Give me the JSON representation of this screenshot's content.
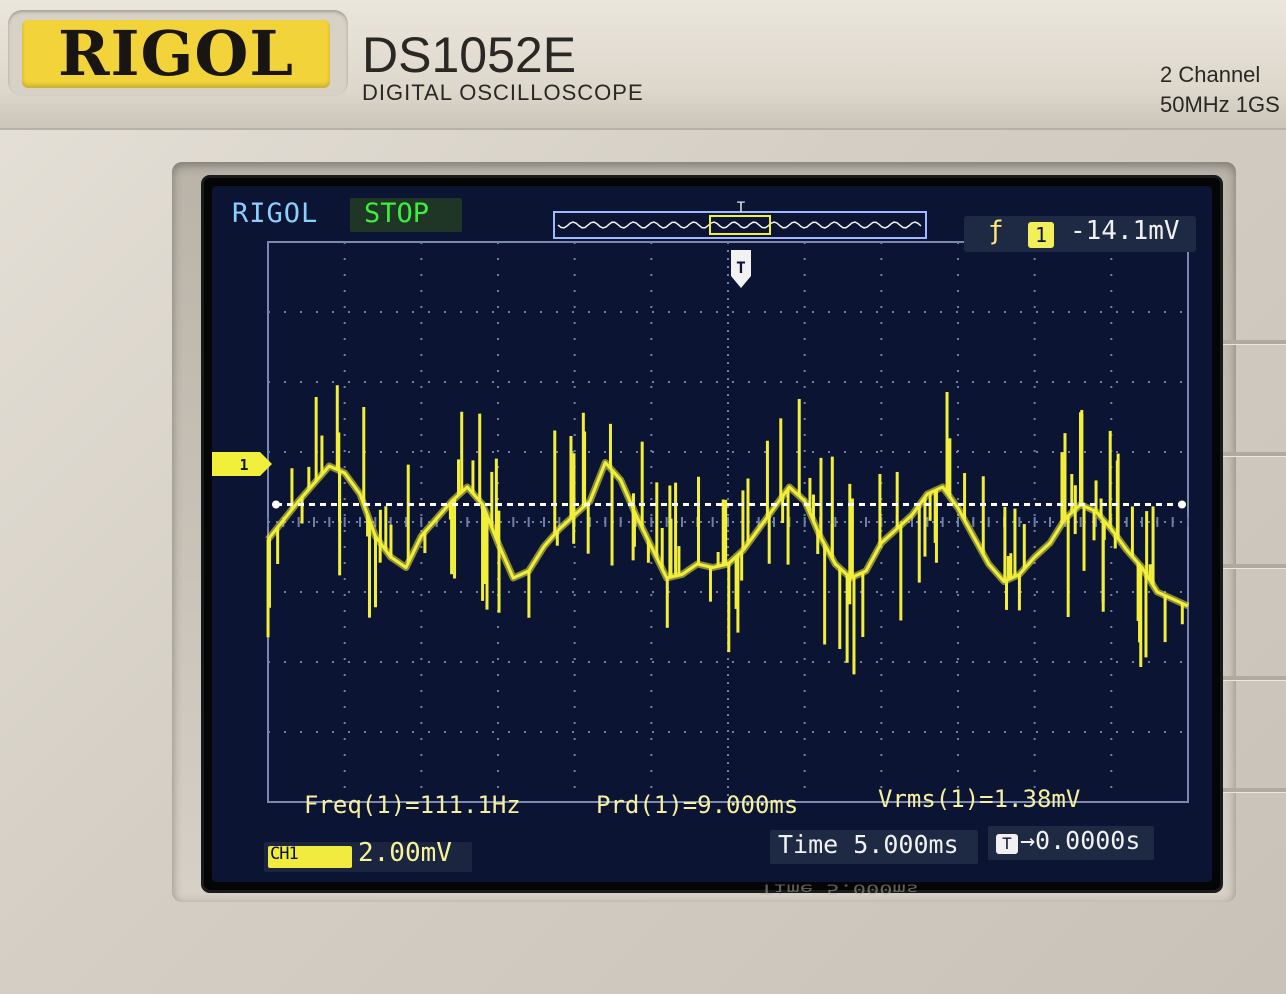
{
  "device": {
    "brand": "RIGOL",
    "model": "DS1052E",
    "subtitle": "DIGITAL OSCILLOSCOPE",
    "spec_channels": "2 Channel",
    "spec_bandwidth": "50MHz 1GS"
  },
  "screen": {
    "brand": "RIGOL",
    "run_status": "STOP",
    "trigger_edge_glyph": "ƒ",
    "trigger_channel": "1",
    "trigger_level": "-14.1mV",
    "trigger_marker": "T",
    "channel_marker": "1",
    "channel_scale_icon": "CH1",
    "channel_scale": "2.00mV",
    "timebase_label": "Time 5.000ms",
    "trigger_offset_icon": "T",
    "trigger_offset": "→0.0000s"
  },
  "measurements": {
    "frequency": "Freq(1)=111.1Hz",
    "period": "Prd(1)=9.000ms",
    "vrms": "Vrms(1)=1.38mV"
  },
  "reflection_text": "Time 5.000ms",
  "colors": {
    "trace": "#f2ef3a",
    "grid": "#6f7ea6",
    "screen_bg": "#0b1433",
    "status_green": "#3cef3c",
    "brand_blue": "#8ad0ff",
    "logo_yellow": "#f2d43a"
  },
  "chart_data": {
    "type": "line",
    "grid": true,
    "divisions": {
      "horizontal": 12,
      "vertical": 8
    },
    "x": [
      -30,
      -28,
      -26,
      -25,
      -24,
      -23,
      -22,
      -21,
      -20,
      -18,
      -17,
      -16,
      -15,
      -14,
      -13,
      -12,
      -11,
      -9,
      -8,
      -7,
      -6,
      -5,
      -4,
      -3,
      -2,
      -1,
      0,
      1,
      2,
      3,
      4,
      5,
      6,
      7,
      8,
      9,
      10,
      12,
      13,
      14,
      15,
      16,
      17,
      18,
      19,
      20,
      21,
      22,
      23,
      24,
      25,
      26,
      27,
      28,
      30
    ],
    "xlabel": "",
    "xlim": [
      -30,
      30
    ],
    "ylabel": "",
    "ylim": [
      -8,
      8
    ],
    "series": [
      {
        "values": [
          -0.5,
          0.6,
          1.6,
          1.4,
          0.8,
          -0.4,
          -1.0,
          -1.3,
          -0.4,
          0.6,
          1.0,
          0.5,
          -0.6,
          -1.6,
          -1.4,
          -0.7,
          -0.2,
          0.6,
          1.7,
          1.2,
          0.2,
          -0.7,
          -1.6,
          -1.5,
          -1.2,
          -1.3,
          -1.2,
          -0.8,
          -0.2,
          0.4,
          1.0,
          0.6,
          -0.4,
          -1.2,
          -1.6,
          -1.4,
          -0.6,
          0.2,
          0.8,
          1.0,
          0.4,
          -0.4,
          -1.2,
          -1.7,
          -1.5,
          -1.0,
          -0.6,
          0.1,
          0.5,
          0.3,
          -0.2,
          -0.8,
          -1.3,
          -2.0,
          -2.4
        ]
      }
    ],
    "annotations": [
      "Freq(1)=111.1Hz",
      "Prd(1)=9.000ms",
      "Vrms(1)=1.38mV"
    ]
  }
}
